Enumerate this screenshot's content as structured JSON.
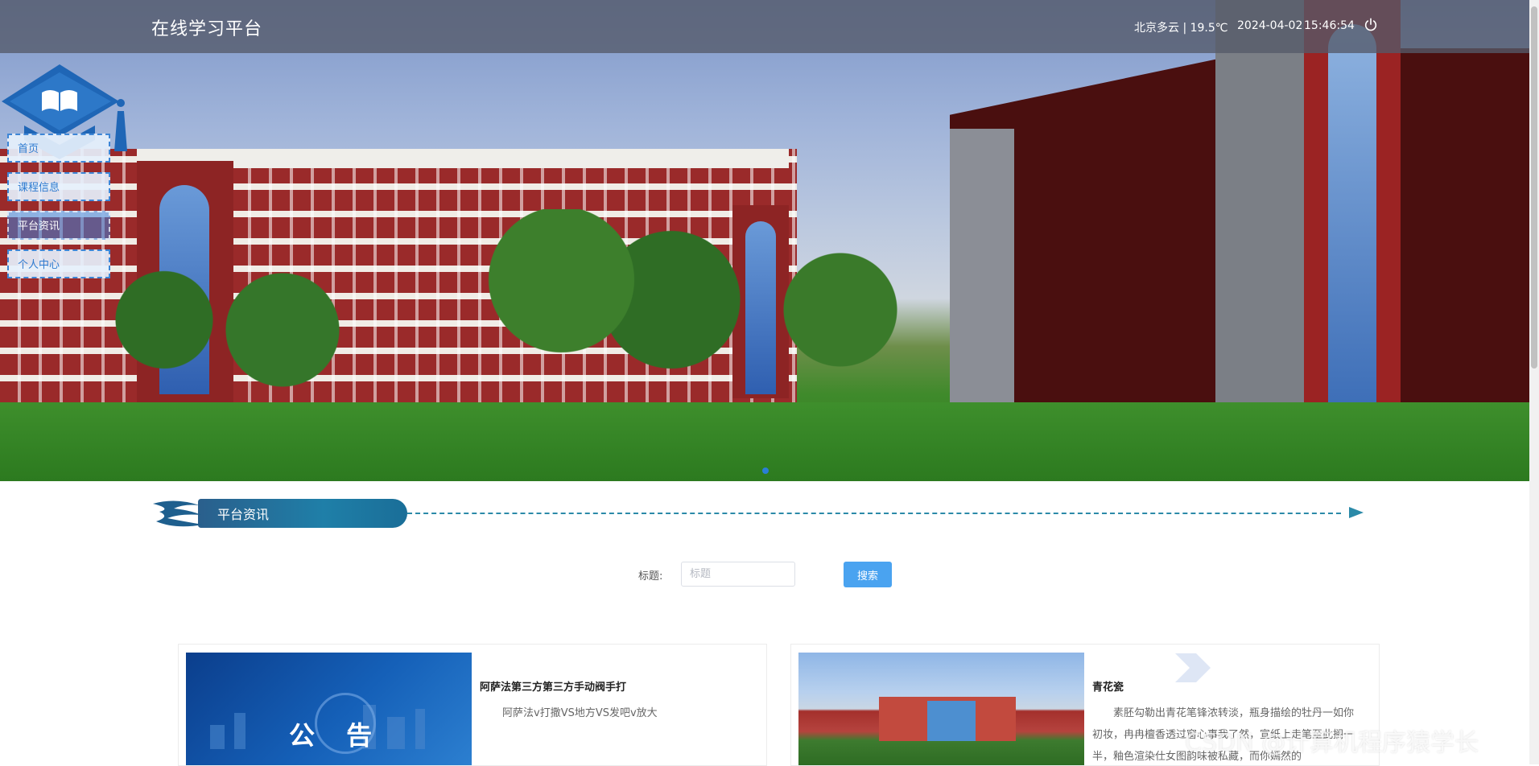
{
  "header": {
    "site_title": "在线学习平台",
    "weather": "北京多云 | 19.5℃",
    "date": "2024-04-02",
    "time": "15:46:54"
  },
  "nav": {
    "items": [
      {
        "label": "首页"
      },
      {
        "label": "课程信息"
      },
      {
        "label": "平台资讯"
      },
      {
        "label": "个人中心"
      }
    ],
    "active": "平台资讯"
  },
  "section": {
    "title": "平台资讯"
  },
  "search": {
    "label": "标题:",
    "placeholder": "标题",
    "value": "",
    "button_label": "搜索"
  },
  "news": [
    {
      "thumb_text": "公 告",
      "title": "阿萨法第三方第三方手动阀手打",
      "summary": "阿萨法v打撒VS地方VS发吧v放大"
    },
    {
      "title": "青花瓷",
      "summary": "素胚勾勒出青花笔锋浓转淡，瓶身描绘的牡丹一如你初妆，冉冉檀香透过窗心事我了然，宣纸上走笔至此搁一半，釉色渲染仕女图韵味被私藏，而你嫣然的"
    }
  ],
  "watermark": "CSDN @计算机程序猿学长",
  "colors": {
    "accent": "#4aa3f0",
    "nav_border": "#3e86d6",
    "section_pill": "#1f7fa8"
  }
}
